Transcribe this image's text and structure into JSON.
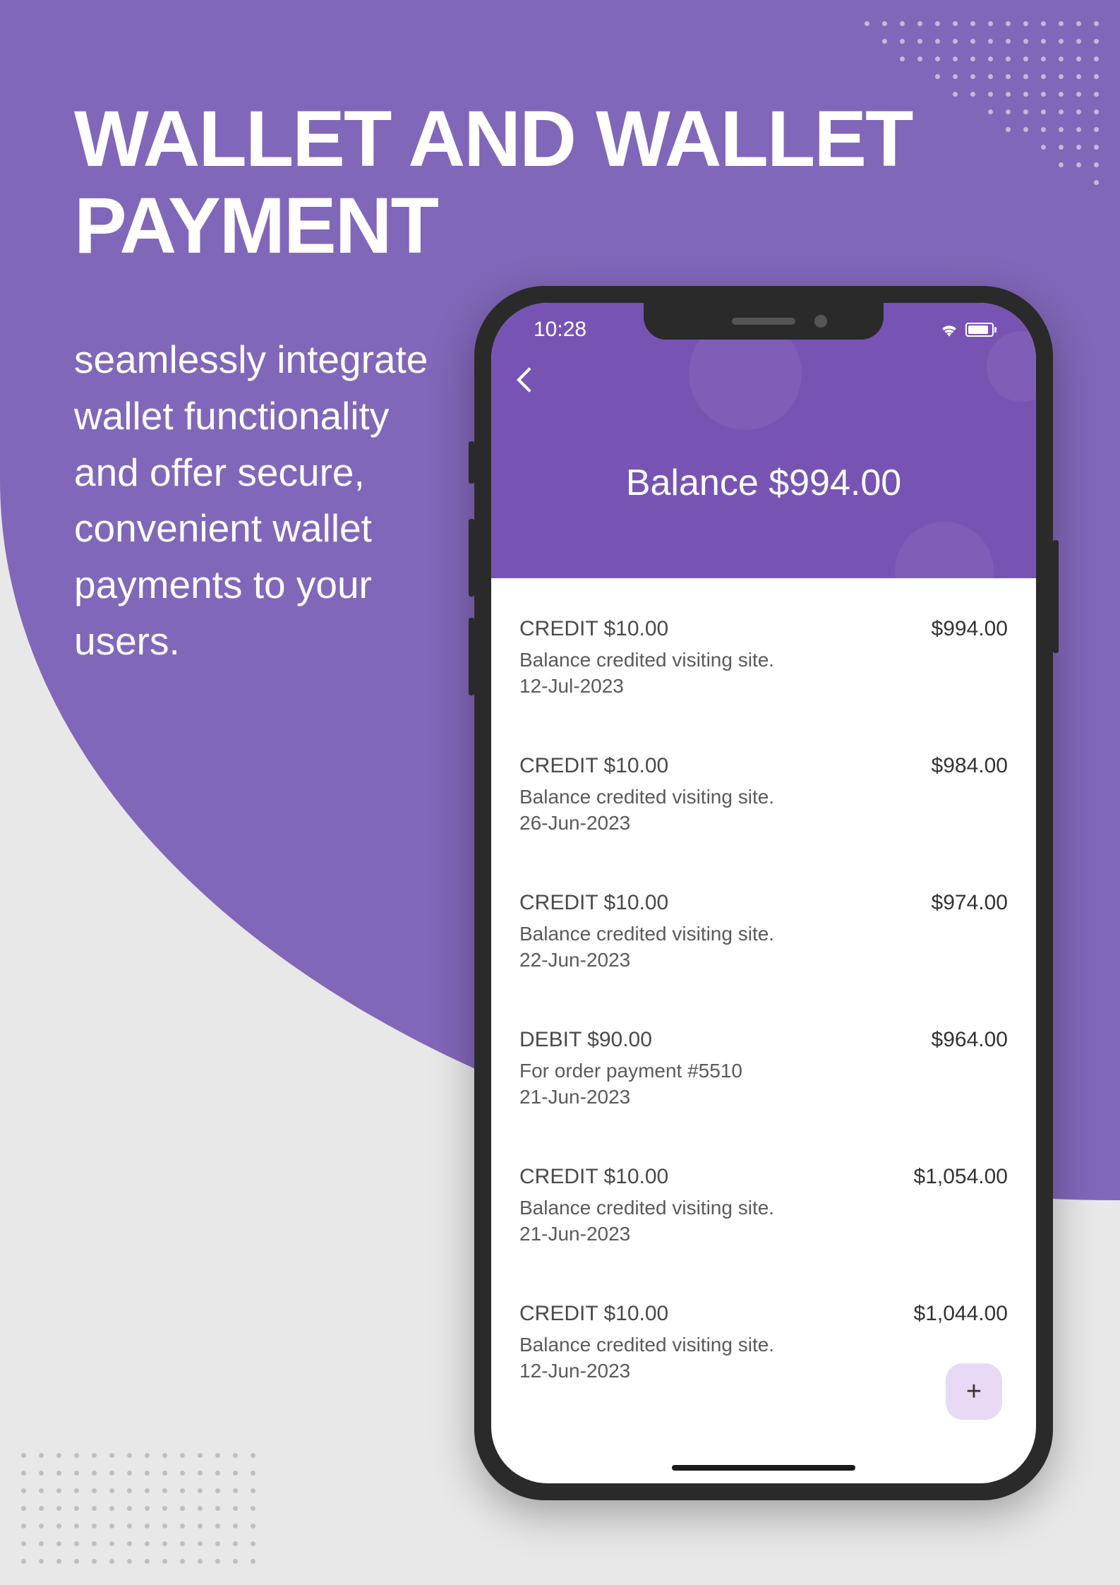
{
  "title": "WALLET AND WALLET PAYMENT",
  "subtitle": "seamlessly integrate wallet functionality and offer secure, convenient wallet payments to your users.",
  "phone": {
    "status_time": "10:28",
    "balance_label": "Balance $994.00",
    "transactions": [
      {
        "type": "CREDIT  $10.00",
        "balance": "$994.00",
        "desc": "Balance credited visiting site.",
        "date": "12-Jul-2023"
      },
      {
        "type": "CREDIT  $10.00",
        "balance": "$984.00",
        "desc": "Balance credited visiting site.",
        "date": "26-Jun-2023"
      },
      {
        "type": "CREDIT  $10.00",
        "balance": "$974.00",
        "desc": "Balance credited visiting site.",
        "date": "22-Jun-2023"
      },
      {
        "type": "DEBIT  $90.00",
        "balance": "$964.00",
        "desc": "For order payment #5510",
        "date": "21-Jun-2023"
      },
      {
        "type": "CREDIT  $10.00",
        "balance": "$1,054.00",
        "desc": "Balance credited visiting site.",
        "date": "21-Jun-2023"
      },
      {
        "type": "CREDIT  $10.00",
        "balance": "$1,044.00",
        "desc": "Balance credited visiting site.",
        "date": "12-Jun-2023"
      }
    ]
  }
}
